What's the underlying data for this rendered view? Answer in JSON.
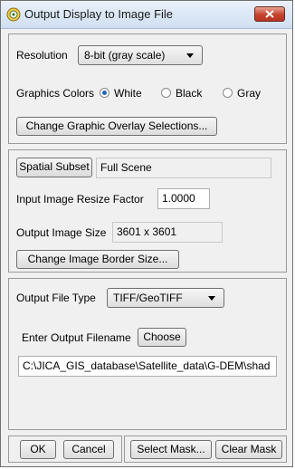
{
  "window": {
    "title": "Output Display to Image File"
  },
  "display": {
    "resolution_label": "Resolution",
    "resolution_value": "8-bit (gray scale)",
    "graphics_colors_label": "Graphics Colors",
    "colors": [
      {
        "label": "White",
        "checked": true
      },
      {
        "label": "Black",
        "checked": false
      },
      {
        "label": "Gray",
        "checked": false
      }
    ],
    "change_overlay_label": "Change Graphic Overlay Selections..."
  },
  "spatial": {
    "subset_button": "Spatial Subset",
    "subset_value": "Full Scene",
    "resize_label": "Input Image Resize Factor",
    "resize_value": "1.0000",
    "output_size_label": "Output Image Size",
    "output_size_value": "3601 x 3601",
    "border_button": "Change Image Border Size..."
  },
  "output": {
    "file_type_label": "Output File Type",
    "file_type_value": "TIFF/GeoTIFF",
    "filename_label": "Enter Output Filename",
    "choose_button": "Choose",
    "filename_value": "C:\\JICA_GIS_database\\Satellite_data\\G-DEM\\shad"
  },
  "footer": {
    "ok": "OK",
    "cancel": "Cancel",
    "select_mask": "Select Mask...",
    "clear_mask": "Clear Mask"
  }
}
